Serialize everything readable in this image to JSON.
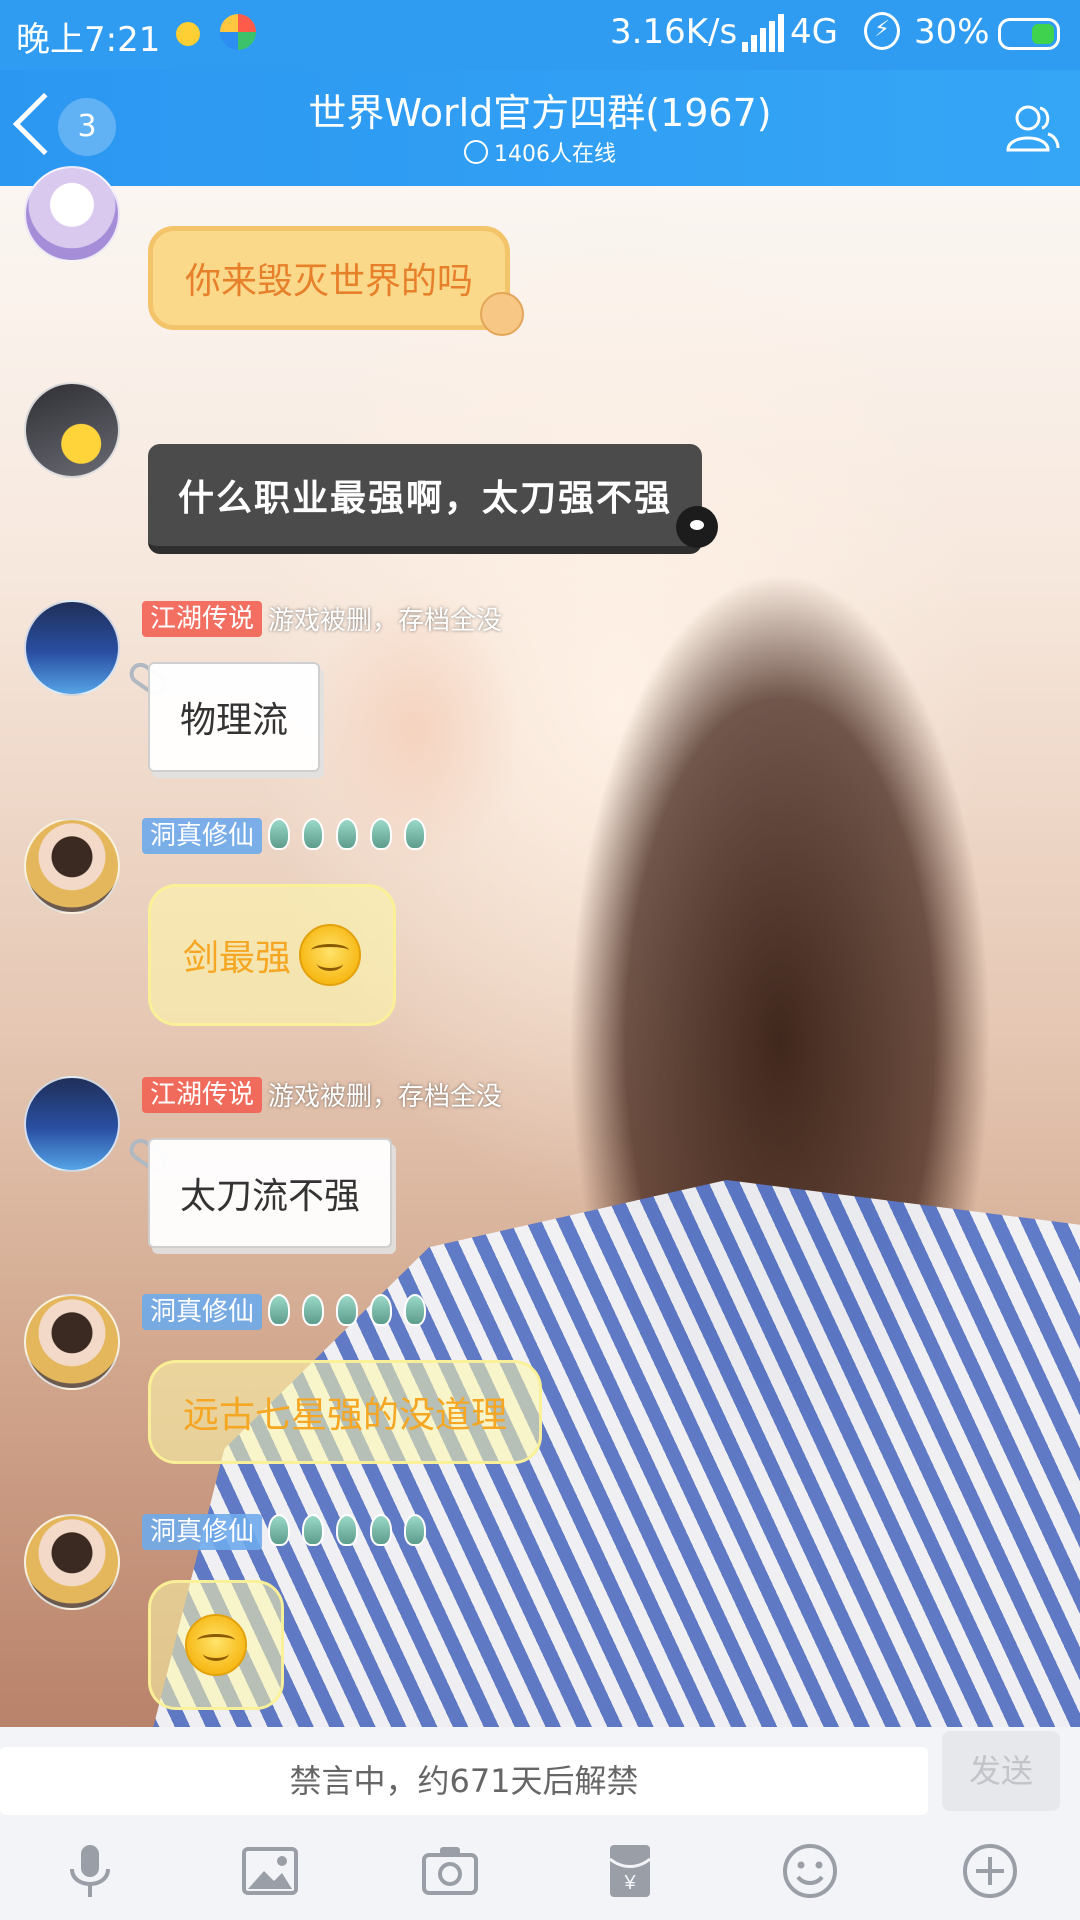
{
  "status_bar": {
    "time": "晚上7:21",
    "speed": "3.16K/s",
    "network": "4G",
    "battery": "30%"
  },
  "header": {
    "back_count": "3",
    "title": "世界World官方四群(1967)",
    "online": "1406人在线"
  },
  "messages": [
    {
      "sender_tag": "",
      "text": "你来毁灭世界的吗",
      "style": "yellow-note"
    },
    {
      "sender_tag": "",
      "text": "什么职业最强啊，太刀强不强",
      "style": "black"
    },
    {
      "sender_tag": "江湖传说",
      "tag_color": "#f15f50",
      "status": "游戏被删，存档全没",
      "text": "物理流",
      "style": "white-note"
    },
    {
      "sender_tag": "洞真修仙",
      "tag_color": "#6eaaeb",
      "text": "剑最强",
      "style": "glass"
    },
    {
      "sender_tag": "江湖传说",
      "tag_color": "#f15f50",
      "status": "游戏被删，存档全没",
      "text": "太刀流不强",
      "style": "white-note"
    },
    {
      "sender_tag": "洞真修仙",
      "tag_color": "#6eaaeb",
      "text": "远古七星强的没道理",
      "style": "glass"
    },
    {
      "sender_tag": "洞真修仙",
      "tag_color": "#6eaaeb",
      "text": "",
      "style": "glass-emoji"
    }
  ],
  "input": {
    "placeholder": "禁言中，约671天后解禁",
    "send_label": "发送"
  },
  "toolbar": [
    "microphone-icon",
    "image-icon",
    "camera-icon",
    "red-packet-icon",
    "emoji-icon",
    "plus-icon"
  ],
  "colors": {
    "accent": "#2f9cf2",
    "send_disabled": "#e7e8ec"
  }
}
